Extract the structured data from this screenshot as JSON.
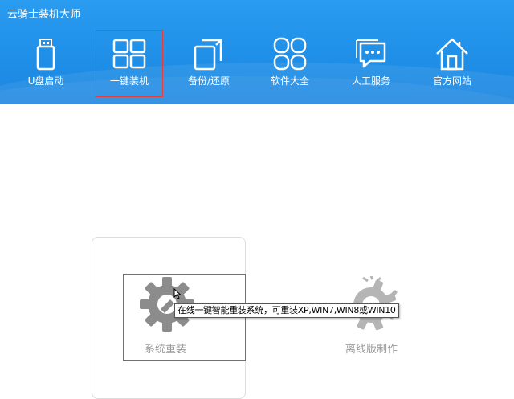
{
  "app": {
    "title": "云骑士装机大师"
  },
  "nav": {
    "items": [
      {
        "label": "U盘启动",
        "icon": "usb-drive-icon"
      },
      {
        "label": "一键装机",
        "icon": "windows-logo-icon",
        "selected": true
      },
      {
        "label": "备份/还原",
        "icon": "backup-restore-icon"
      },
      {
        "label": "软件大全",
        "icon": "app-grid-icon"
      },
      {
        "label": "人工服务",
        "icon": "chat-bubble-icon"
      },
      {
        "label": "官方网站",
        "icon": "home-icon"
      }
    ]
  },
  "modes": {
    "online": {
      "label": "系统重装",
      "icon": "gear-icon"
    },
    "offline": {
      "label": "离线版制作",
      "icon": "gear-wrench-icon"
    }
  },
  "tooltip": {
    "text": "在线一键智能重装系统，可重装XP,WIN7,WIN8或WIN10"
  },
  "colors": {
    "header": "#1f8fe8",
    "selection": "#e04040",
    "muted": "#9a9a9a"
  }
}
